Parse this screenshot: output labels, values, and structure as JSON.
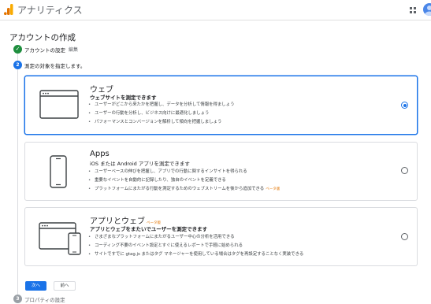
{
  "header": {
    "app_title": "アナリティクス"
  },
  "page": {
    "title": "アカウントの作成"
  },
  "steps": [
    {
      "number": "✓",
      "label": "アカウントの設定",
      "edit_label": "編集"
    },
    {
      "number": "2",
      "label": "測定の対象を指定します。"
    },
    {
      "number": "3",
      "label": "プロパティの設定"
    }
  ],
  "options": [
    {
      "title": "ウェブ",
      "subtitle": "ウェブサイトを測定できます",
      "bullets": [
        "ユーザーがどこから来たかを把握し、データを分析して情報を得ましょう",
        "ユーザーの行動を分析し、ビジネス向けに最適化しましょう",
        "パフォーマンスとコンバージョンを解析して傾向を把握しましょう"
      ],
      "selected": true,
      "icon": "browser-window-icon"
    },
    {
      "title": "Apps",
      "subtitle": "iOS または Android アプリを測定できます",
      "bullets": [
        "ユーザーベースの伸びを把握し、アプリでの行動に関するインサイトを得られる",
        "重要なイベントを自動的に記録したり、独自のイベントを定義できる",
        "プラットフォームにまたがる行動を測定するためのウェブストリームを後から追加できる"
      ],
      "bullet_badge": "ベータ版",
      "selected": false,
      "icon": "mobile-phone-icon"
    },
    {
      "title": "アプリとウェブ",
      "title_badge": "ベータ版",
      "subtitle": "アプリとウェブをまたいでユーザーを測定できます",
      "bullets": [
        "さまざまなプラットフォームにまたがるユーザー中心の分析を活用できる",
        "コーディング不要のイベント設定とすぐに使えるレポートで手軽に始められる",
        "サイトですでに gtag.js またはタグ マネージャーを使用している場合はタグを再設定することなく実装できる"
      ],
      "selected": false,
      "icon": "browser-and-phone-icon"
    }
  ],
  "buttons": {
    "next": "次へ",
    "previous": "前へ"
  },
  "colors": {
    "primary": "#1a73e8",
    "success": "#1e8e3e",
    "beta": "#e37400"
  }
}
